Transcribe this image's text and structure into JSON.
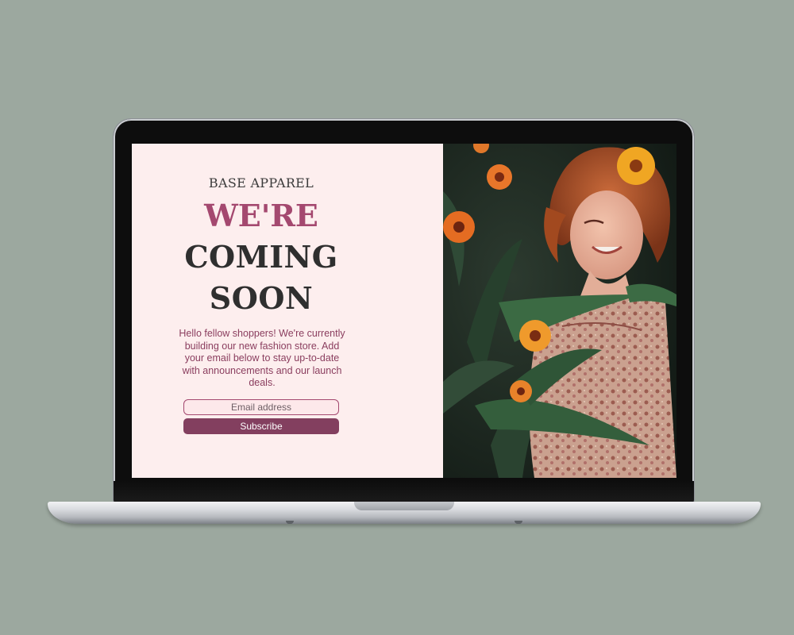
{
  "page": {
    "brand": "BASE APPAREL",
    "headline": {
      "line1": "WE'RE",
      "line2": "COMING",
      "line3": "SOON"
    },
    "description": "Hello fellow shoppers! We're currently building our new fashion store. Add your email below to stay up-to-date with announcements and our launch deals.",
    "email": {
      "placeholder": "Email address",
      "value": ""
    },
    "subscribe_label": "Subscribe",
    "hero_image": "woman-with-flowers-photo"
  },
  "colors": {
    "background": "#9ca89f",
    "panel": "#fdeeee",
    "accent": "#a4486f",
    "button": "#833f5f",
    "text_dark": "#2f2f2f",
    "text_body": "#8a3d5e"
  }
}
